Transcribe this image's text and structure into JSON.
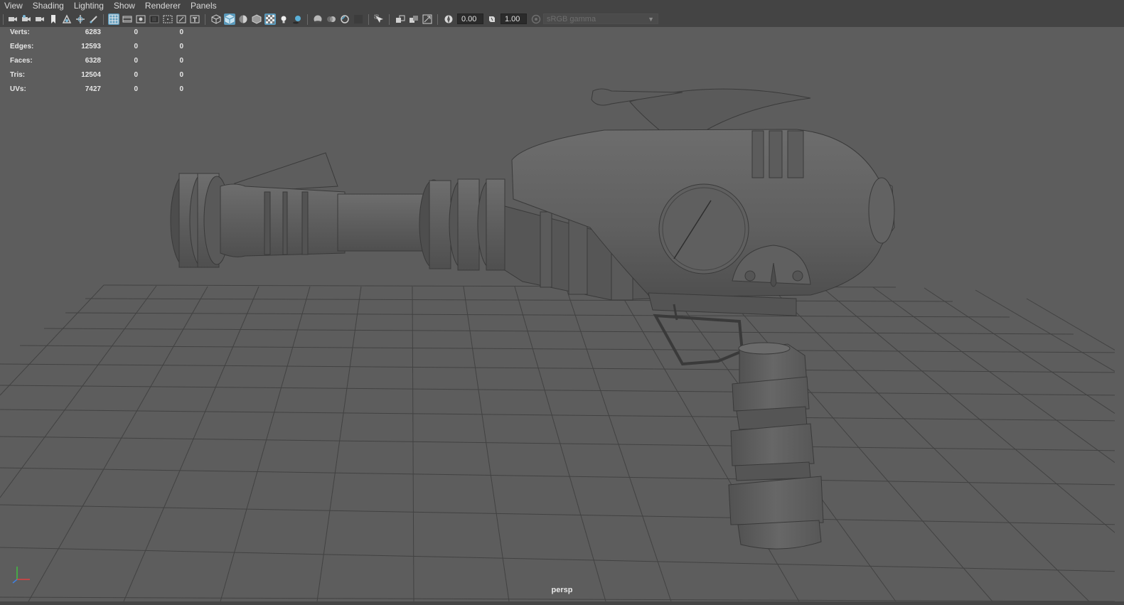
{
  "menu": {
    "items": [
      "View",
      "Shading",
      "Lighting",
      "Show",
      "Renderer",
      "Panels"
    ]
  },
  "toolbar": {
    "exposure_value": "0.00",
    "gamma_value": "1.00",
    "color_space": "sRGB gamma",
    "icons": [
      "select-camera-icon",
      "camera-attributes-icon",
      "camera-bookmark-icon",
      "image-plane-icon",
      "bookmark-icon",
      "2d-pan-zoom-icon",
      "grease-pencil-icon",
      "grid-icon",
      "film-gate-icon",
      "resolution-gate-icon",
      "gate-mask-icon",
      "field-chart-icon",
      "safe-action-icon",
      "safe-title-icon",
      "wireframe-icon",
      "smooth-shade-icon",
      "default-material-icon",
      "xray-icon",
      "use-all-lights-icon",
      "shadows-icon",
      "screen-space-ao-icon",
      "motion-blur-icon",
      "multisample-aa-icon",
      "depth-of-field-icon",
      "isolate-select-icon",
      "xray-joints-icon",
      "xray-active-components-icon",
      "backface-culling-icon",
      "exposure-icon",
      "gamma-icon",
      "color-management-icon"
    ]
  },
  "hud": {
    "rows": [
      {
        "label": "Verts:",
        "v1": "6283",
        "v2": "0",
        "v3": "0"
      },
      {
        "label": "Edges:",
        "v1": "12593",
        "v2": "0",
        "v3": "0"
      },
      {
        "label": "Faces:",
        "v1": "6328",
        "v2": "0",
        "v3": "0"
      },
      {
        "label": "Tris:",
        "v1": "12504",
        "v2": "0",
        "v3": "0"
      },
      {
        "label": "UVs:",
        "v1": "7427",
        "v2": "0",
        "v3": "0"
      }
    ]
  },
  "viewport": {
    "camera": "persp",
    "background_color": "#5d5d5d",
    "grid_color": "#3f3f3f",
    "model_color": "#606060"
  },
  "axis": {
    "x_color": "#e04040",
    "y_color": "#40c040",
    "z_color": "#4080e0"
  }
}
